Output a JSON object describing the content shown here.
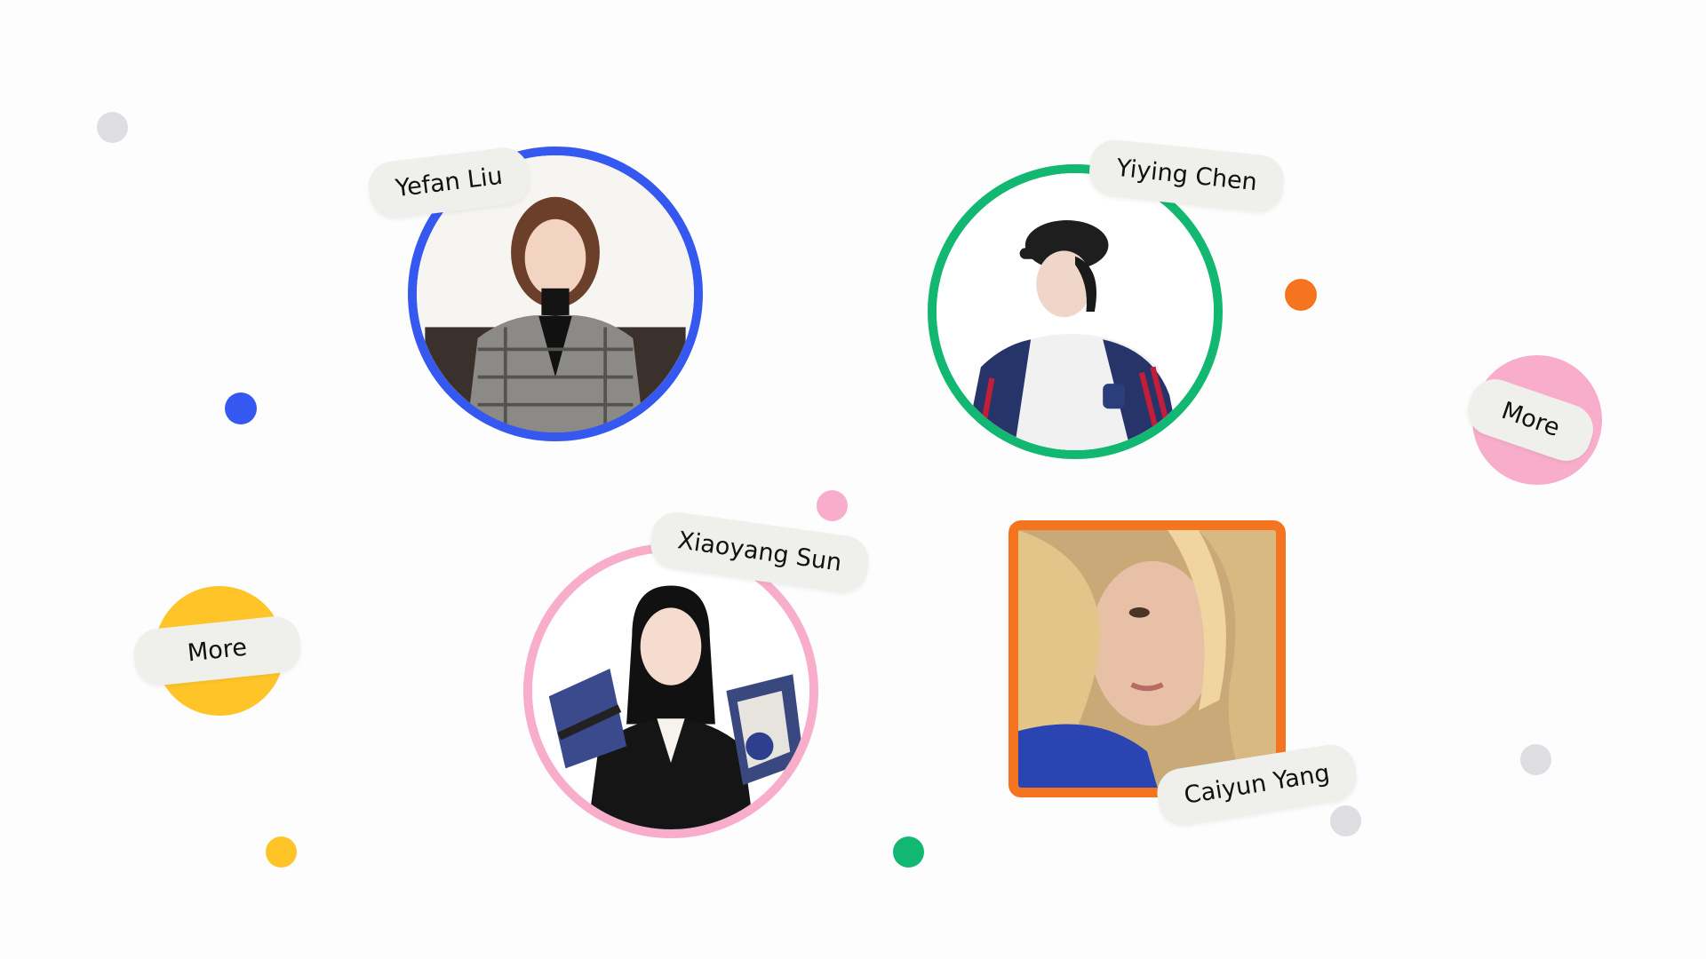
{
  "colors": {
    "blue": "#3558f0",
    "green": "#12b872",
    "pink": "#f8aecb",
    "orange": "#f5741f",
    "yellow": "#ffc528",
    "gray": "#dedde2",
    "pill_bg": "#efefec"
  },
  "members": [
    {
      "name": "Yefan Liu",
      "frame": "circle",
      "frame_color": "blue",
      "photo": "person-photo"
    },
    {
      "name": "Yiying Chen",
      "frame": "circle",
      "frame_color": "green",
      "photo": "person-photo"
    },
    {
      "name": "Xiaoyang Sun",
      "frame": "circle",
      "frame_color": "pink",
      "photo": "person-photo"
    },
    {
      "name": "Caiyun Yang",
      "frame": "rounded-square",
      "frame_color": "orange",
      "photo": "person-photo"
    }
  ],
  "more_buttons": [
    {
      "label": "More",
      "badge_color": "pink"
    },
    {
      "label": "More",
      "badge_color": "yellow"
    }
  ]
}
